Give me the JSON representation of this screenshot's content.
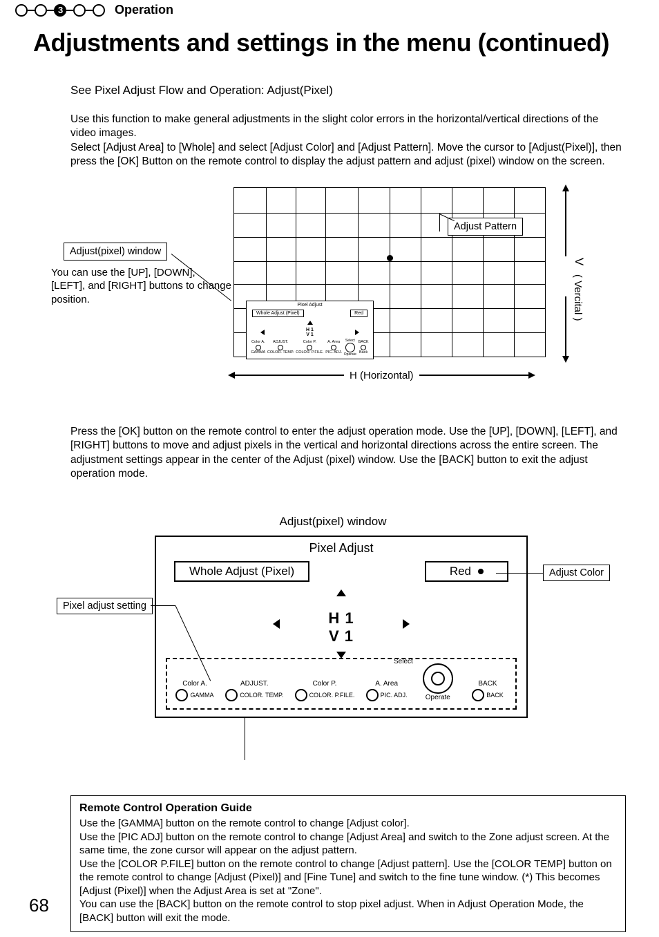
{
  "header": {
    "section": "Operation"
  },
  "title": "Adjustments and settings in the menu (continued)",
  "intro_line": "See Pixel Adjust Flow and Operation: Adjust(Pixel)",
  "paragraph1": "Use this function to make general adjustments in the slight color errors in  the horizontal/vertical directions of the video images.\nSelect [Adjust Area] to [Whole] and select [Adjust Color] and [Adjust Pattern]. Move the cursor to [Adjust(Pixel)], then press the [OK] Button on the remote control to display the adjust pattern and adjust (pixel) window on the screen.",
  "diagram1": {
    "apw_label": "Adjust(pixel) window",
    "side_note": "You can use the [UP], [DOWN], [LEFT], and [RIGHT] buttons to change position.",
    "pattern_label": "Adjust Pattern",
    "h_label": "H (Horizontal)",
    "v_label": "( Vercital )",
    "v_letter": "V",
    "mini": {
      "title": "Pixel Adjust",
      "mode": "Whole Adjust (Pixel)",
      "color": "Red",
      "h": "H    1",
      "v": "V    1",
      "btns": {
        "colorA": "Color A.",
        "gamma": "GAMMA",
        "adjust": "ADJUST.",
        "ctemp": "COLOR. TEMP.",
        "colorP": "Color P.",
        "cpfile": "COLOR. P.FILE.",
        "aarea": "A. Area",
        "picadj": "PIC. ADJ.",
        "select": "Select",
        "operate": "Operate",
        "back_top": "BACK",
        "back_bot": "Back"
      }
    }
  },
  "paragraph2": "Press the [OK] button on the remote control to enter the adjust operation mode. Use the [UP], [DOWN], [LEFT], and [RIGHT] buttons to move and adjust pixels in the vertical and horizontal directions across the entire screen. The adjustment settings appear in the center of the Adjust (pixel) window. Use the [BACK] button to exit the adjust operation mode.",
  "diagram2": {
    "title": "Adjust(pixel) window",
    "win_title": "Pixel Adjust",
    "mode_pill": "Whole Adjust (Pixel)",
    "color_pill": "Red",
    "h_row": "H     1",
    "v_row": "V     1",
    "side_left": "Pixel adjust setting",
    "side_right": "Adjust Color",
    "bottom": {
      "colorA": "Color A.",
      "gamma": "GAMMA",
      "adjust": "ADJUST.",
      "ctemp": "COLOR. TEMP.",
      "colorP": "Color P.",
      "cpfile": "COLOR. P.FILE.",
      "aarea": "A. Area",
      "picadj": "PIC. ADJ.",
      "select": "Select",
      "operate": "Operate",
      "back_top": "BACK",
      "back_bot": "BACK"
    }
  },
  "guide": {
    "title": "Remote Control Operation Guide",
    "body": "Use the [GAMMA] button on the remote control to change [Adjust color].\nUse the [PIC ADJ] button on the remote control to change [Adjust Area] and switch to the Zone adjust screen. At the same time, the zone cursor will appear on the adjust pattern.\nUse the [COLOR P.FILE] button on the remote control to change [Adjust pattern]. Use the [COLOR TEMP] button on the remote control to change [Adjust (Pixel)] and [Fine Tune] and switch to the fine tune window. (*) This becomes [Adjust (Pixel)] when the Adjust Area is set at \"Zone\".\nYou can use the [BACK] button on the remote control to stop pixel adjust. When in Adjust Operation Mode, the [BACK] button will exit the mode."
  },
  "page_number": "68"
}
